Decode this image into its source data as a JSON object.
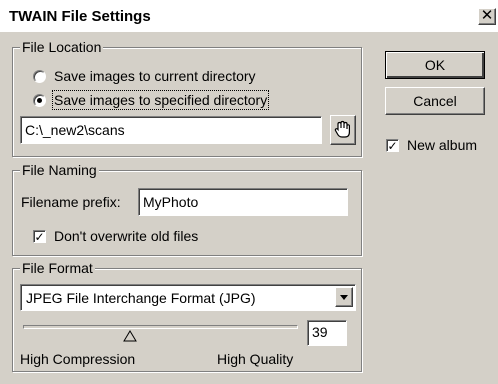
{
  "window": {
    "title": "TWAIN File Settings",
    "close_label": "✕"
  },
  "file_location": {
    "legend": "File Location",
    "radio_current_label": "Save images to current directory",
    "radio_current_selected": false,
    "radio_specified_label": "Save images to specified directory",
    "radio_specified_selected": true,
    "directory_value": "C:\\_new2\\scans",
    "browse_icon": "hand-pointer-icon"
  },
  "file_naming": {
    "legend": "File Naming",
    "prefix_label": "Filename prefix:",
    "prefix_value": "MyPhoto",
    "overwrite_label": "Don't overwrite old files",
    "overwrite_checked": true,
    "check_mark": "✓"
  },
  "file_format": {
    "legend": "File Format",
    "format_selected": "JPEG File Interchange Format (JPG)",
    "quality_value": "39",
    "quality_fraction": 0.39,
    "low_label": "High Compression",
    "high_label": "High Quality"
  },
  "buttons": {
    "ok_label": "OK",
    "cancel_label": "Cancel"
  },
  "options": {
    "new_album_label": "New album",
    "new_album_checked": true,
    "check_mark": "✓"
  }
}
